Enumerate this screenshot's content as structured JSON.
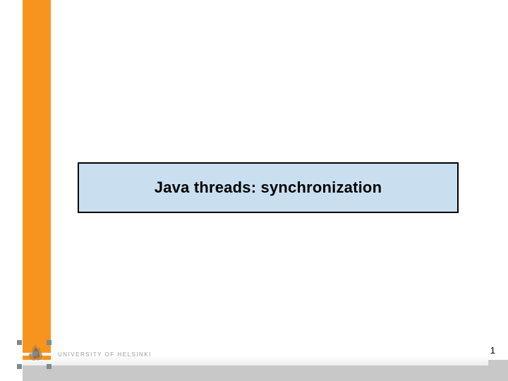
{
  "slide": {
    "title": "Java threads: synchronization"
  },
  "footer": {
    "university_label": "UNIVERSITY OF HELSINKI",
    "page_number": "1"
  },
  "colors": {
    "orange": "#f7941e",
    "title_bg": "#c9dff0",
    "footer_grey": "#c8c8c8"
  }
}
